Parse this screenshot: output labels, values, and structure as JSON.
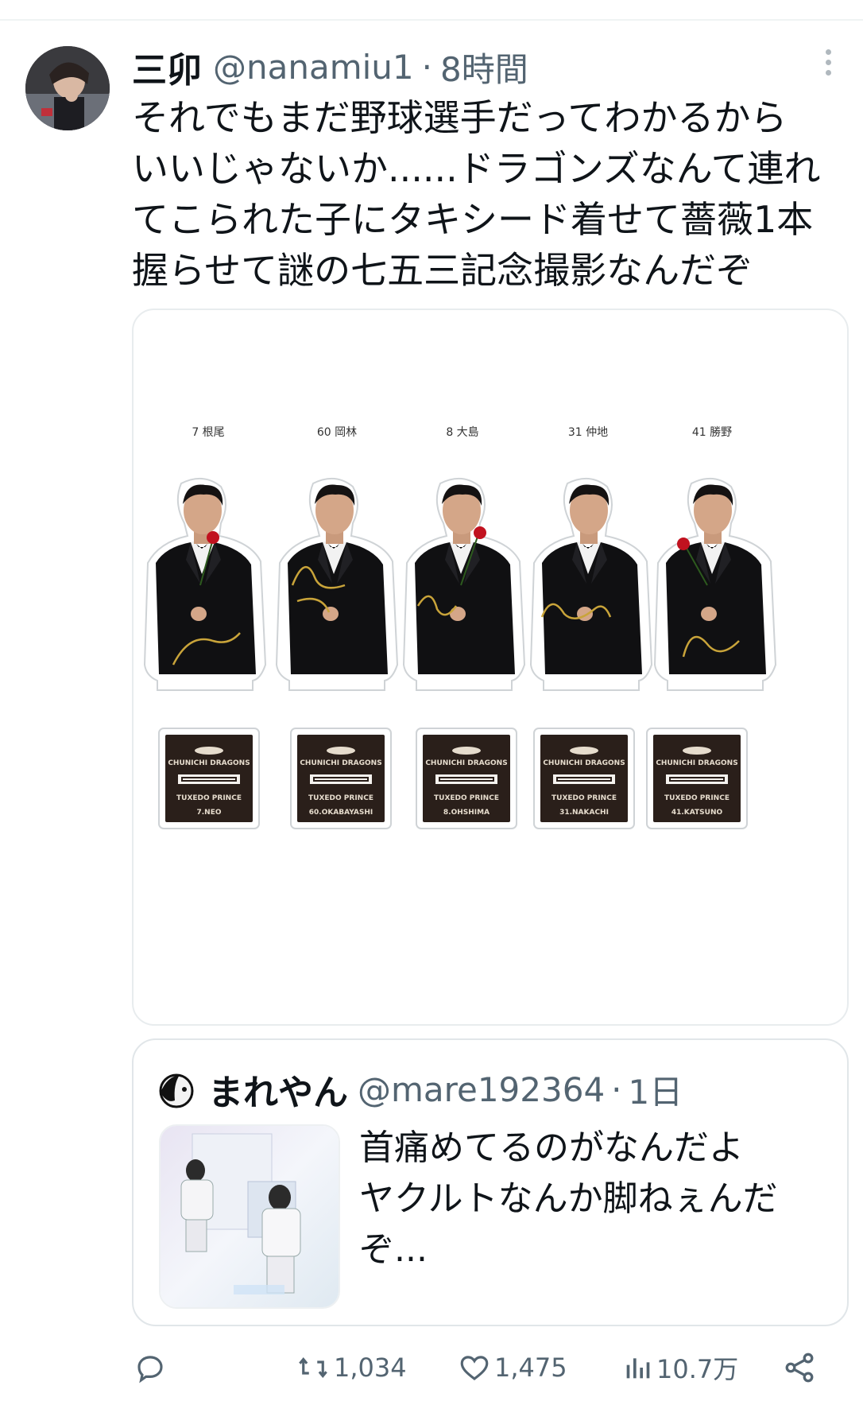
{
  "tweet": {
    "author_name": "三卯",
    "author_handle": "@nanamiu1",
    "separator": "·",
    "time": "8時間",
    "text": "それでもまだ野球選手だってわかるから\nいいじゃないか......ドラゴンズなんて連れ\nてこられた子にタキシード着せて薔薇1本\n握らせて謎の七五三記念撮影なんだぞ"
  },
  "media": {
    "players": [
      {
        "top_label": "7 根尾",
        "plate_name": "7.NEO"
      },
      {
        "top_label": "60 岡林",
        "plate_name": "60.OKABAYASHI"
      },
      {
        "top_label": "8 大島",
        "plate_name": "8.OHSHIMA"
      },
      {
        "top_label": "31 仲地",
        "plate_name": "31.NAKACHI"
      },
      {
        "top_label": "41 勝野",
        "plate_name": "41.KATSUNO"
      }
    ],
    "plate_team": "CHUNICHI DRAGONS",
    "plate_title": "TUXEDO PRINCE"
  },
  "quote": {
    "author_name": "まれやん",
    "author_handle": "@mare192364",
    "separator": "·",
    "time": "1日",
    "text": "首痛めてるのがなんだよ\nヤクルトなんか脚ねぇんだ\nぞ..."
  },
  "actions": {
    "reply_icon": "reply-icon",
    "retweet_count": "1,034",
    "like_count": "1,475",
    "views_count": "10.7万",
    "share_icon": "share-icon"
  },
  "colors": {
    "text": "#0f1419",
    "muted": "#536471",
    "border": "#e1e6e9",
    "plate_bg": "#2a1f1a",
    "gold": "#c9a43a",
    "rose": "#c1121f"
  }
}
